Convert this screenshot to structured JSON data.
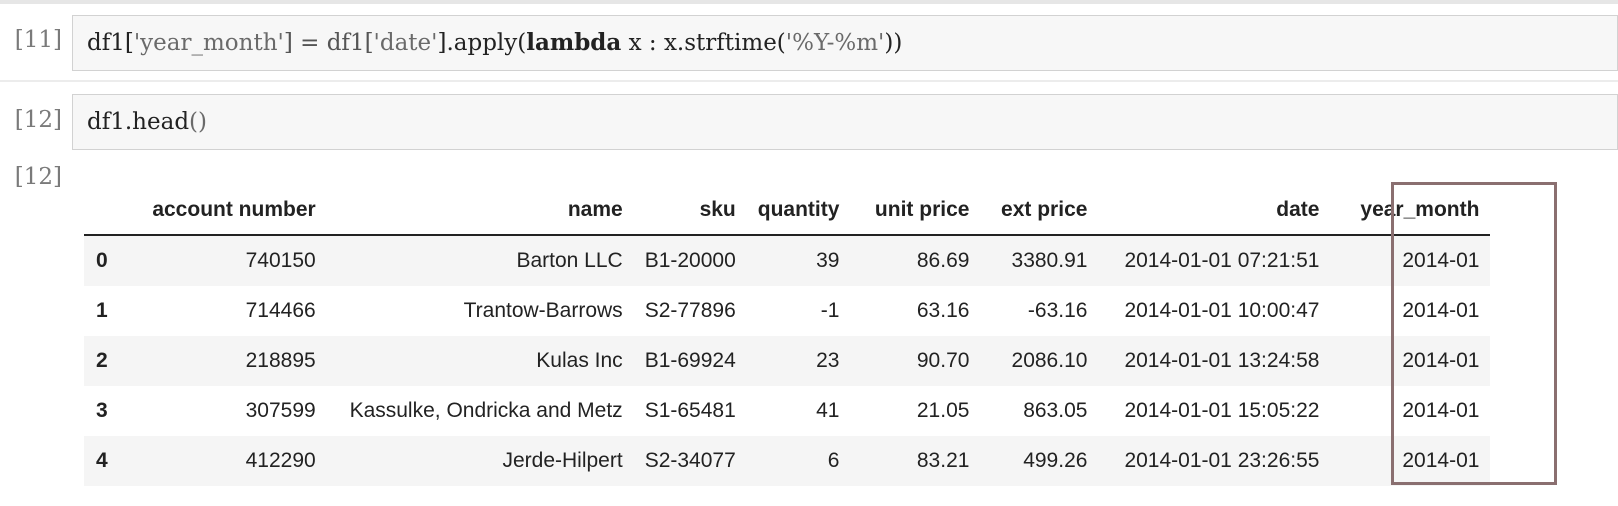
{
  "cells": [
    {
      "prompt": "[11]",
      "code": {
        "p1": "df1[",
        "s1": "'year_month'",
        "p2": "] = df1[",
        "s2": "'date'",
        "p3": "].apply(",
        "kw": "lambda",
        "p4": " x : x.strftime(",
        "s3": "'%Y-%m'",
        "p5": "))"
      }
    },
    {
      "prompt": "[12]",
      "code": {
        "p1": "df1.head",
        "p2": "()"
      }
    }
  ],
  "output": {
    "prompt": "[12]",
    "columns": [
      "",
      "account number",
      "name",
      "sku",
      "quantity",
      "unit price",
      "ext price",
      "date",
      "year_month"
    ],
    "rows": [
      [
        "0",
        "740150",
        "Barton LLC",
        "B1-20000",
        "39",
        "86.69",
        "3380.91",
        "2014-01-01 07:21:51",
        "2014-01"
      ],
      [
        "1",
        "714466",
        "Trantow-Barrows",
        "S2-77896",
        "-1",
        "63.16",
        "-63.16",
        "2014-01-01 10:00:47",
        "2014-01"
      ],
      [
        "2",
        "218895",
        "Kulas Inc",
        "B1-69924",
        "23",
        "90.70",
        "2086.10",
        "2014-01-01 13:24:58",
        "2014-01"
      ],
      [
        "3",
        "307599",
        "Kassulke, Ondricka and Metz",
        "S1-65481",
        "41",
        "21.05",
        "863.05",
        "2014-01-01 15:05:22",
        "2014-01"
      ],
      [
        "4",
        "412290",
        "Jerde-Hilpert",
        "S2-34077",
        "6",
        "83.21",
        "499.26",
        "2014-01-01 23:26:55",
        "2014-01"
      ]
    ]
  }
}
